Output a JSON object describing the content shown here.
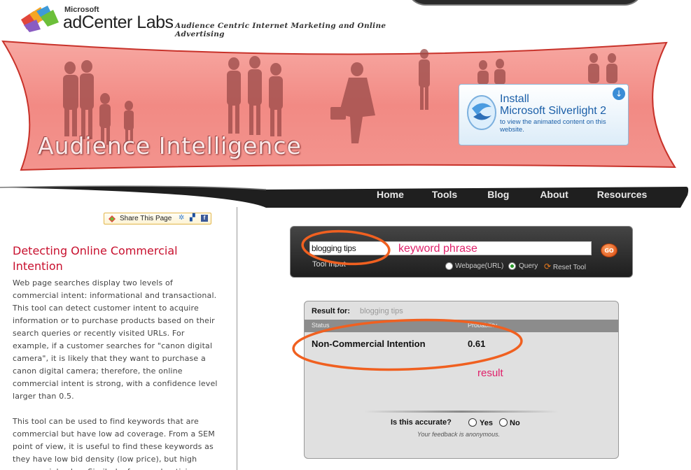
{
  "logo": {
    "brand_small": "Microsoft",
    "brand_name": "adCenter Labs",
    "tagline": "Audience Centric Internet Marketing and Online Advertising"
  },
  "banner": {
    "title": "Audience Intelligence",
    "color": "#f08c8c"
  },
  "silverlight": {
    "line1": "Install",
    "line2": "Microsoft Silverlight",
    "version": "2",
    "sub": "to view the animated content on this website."
  },
  "nav": {
    "items": [
      "Home",
      "Tools",
      "Blog",
      "About",
      "Resources"
    ]
  },
  "share": {
    "label": "Share This Page"
  },
  "article": {
    "title": "Detecting Online Commercial Intention",
    "paragraphs": [
      "Web page searches display two levels of commercial intent: informational and transactional. This tool can detect customer intent to acquire information or to purchase products based on their search queries or recently visited URLs. For example, if a customer searches for \"canon digital camera\", it is likely that they want to purchase a canon digital camera; therefore, the online commercial intent is strong, with a confidence level larger than 0.5.",
      "This tool can be used to find keywords that are commercial but have low ad coverage. From a SEM point of view, it is useful to find these keywords as they have low bid density (low price), but high commercial value. Similarly, for an advertizing"
    ]
  },
  "tool": {
    "input_value": "blogging tips",
    "label": "Tool Input",
    "go_label": "GO",
    "options": [
      "Webpage(URL)",
      "Query"
    ],
    "selected": "Query",
    "reset": "Reset Tool"
  },
  "result": {
    "result_for_label": "Result for:",
    "query": "blogging tips",
    "col_status": "Status",
    "col_prob": "Probability",
    "status": "Non-Commercial Intention",
    "probability": "0.61",
    "accurate_question": "Is this accurate?",
    "yes": "Yes",
    "no": "No",
    "anonymous_note": "Your feedback is anonymous."
  },
  "annotations": {
    "keyword_phrase": "keyword phrase",
    "result": "result",
    "color": "#f06020"
  }
}
